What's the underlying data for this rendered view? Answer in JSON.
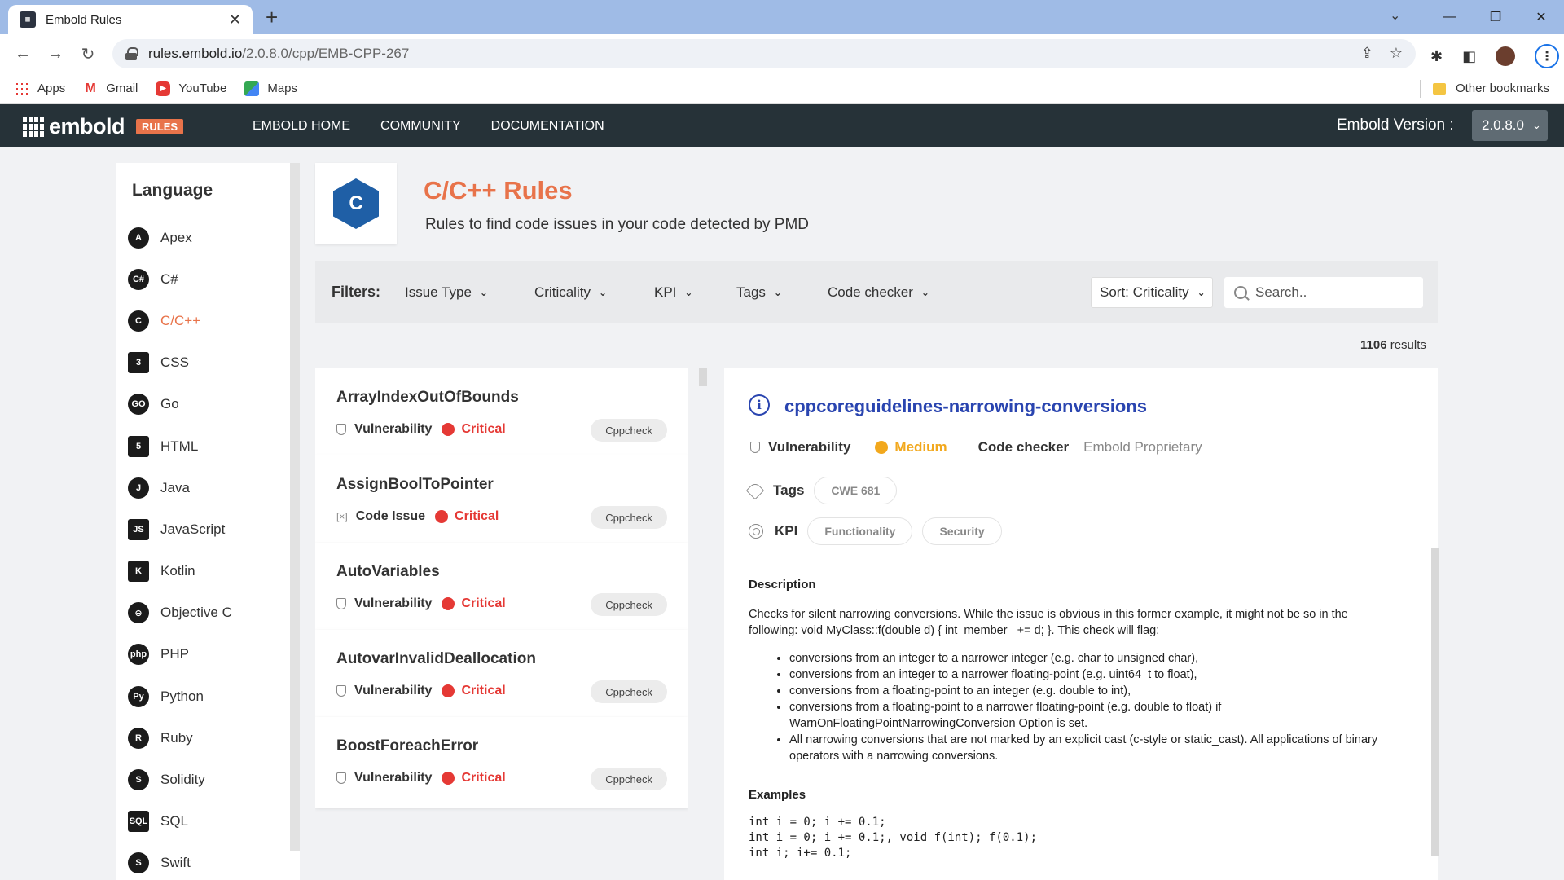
{
  "browser": {
    "tab_title": "Embold Rules",
    "url_host": "rules.embold.io",
    "url_path": "/2.0.8.0/cpp/EMB-CPP-267",
    "bookmarks": [
      "Apps",
      "Gmail",
      "YouTube",
      "Maps"
    ],
    "other_bookmarks": "Other bookmarks"
  },
  "header": {
    "logo": "embold",
    "badge": "RULES",
    "nav": [
      "EMBOLD HOME",
      "COMMUNITY",
      "DOCUMENTATION"
    ],
    "version_label": "Embold Version :",
    "version_value": "2.0.8.0"
  },
  "sidebar": {
    "title": "Language",
    "items": [
      {
        "label": "Apex",
        "icon": "apex-icon",
        "glyph": "A"
      },
      {
        "label": "C#",
        "icon": "csharp-icon",
        "glyph": "C#"
      },
      {
        "label": "C/C++",
        "icon": "cpp-icon",
        "glyph": "C",
        "active": true
      },
      {
        "label": "CSS",
        "icon": "css-icon",
        "glyph": "3"
      },
      {
        "label": "Go",
        "icon": "go-icon",
        "glyph": "GO"
      },
      {
        "label": "HTML",
        "icon": "html-icon",
        "glyph": "5"
      },
      {
        "label": "Java",
        "icon": "java-icon",
        "glyph": "J"
      },
      {
        "label": "JavaScript",
        "icon": "javascript-icon",
        "glyph": "JS"
      },
      {
        "label": "Kotlin",
        "icon": "kotlin-icon",
        "glyph": "K"
      },
      {
        "label": "Objective C",
        "icon": "objective-c-icon",
        "glyph": "⊖"
      },
      {
        "label": "PHP",
        "icon": "php-icon",
        "glyph": "php"
      },
      {
        "label": "Python",
        "icon": "python-icon",
        "glyph": "Py"
      },
      {
        "label": "Ruby",
        "icon": "ruby-icon",
        "glyph": "R"
      },
      {
        "label": "Solidity",
        "icon": "solidity-icon",
        "glyph": "S"
      },
      {
        "label": "SQL",
        "icon": "sql-icon",
        "glyph": "SQL"
      },
      {
        "label": "Swift",
        "icon": "swift-icon",
        "glyph": "S"
      }
    ]
  },
  "page": {
    "title": "C/C++ Rules",
    "subtitle": "Rules to find code issues in your code detected by PMD"
  },
  "filters": {
    "label": "Filters:",
    "dropdowns": [
      "Issue Type",
      "Criticality",
      "KPI",
      "Tags",
      "Code checker"
    ],
    "sort": "Sort: Criticality",
    "search_placeholder": "Search.."
  },
  "results": {
    "count": "1106",
    "label": "results"
  },
  "rules": [
    {
      "name": "ArrayIndexOutOfBounds",
      "type": "Vulnerability",
      "criticality": "Critical",
      "checker": "Cppcheck"
    },
    {
      "name": "AssignBoolToPointer",
      "type": "Code Issue",
      "criticality": "Critical",
      "checker": "Cppcheck"
    },
    {
      "name": "AutoVariables",
      "type": "Vulnerability",
      "criticality": "Critical",
      "checker": "Cppcheck"
    },
    {
      "name": "AutovarInvalidDeallocation",
      "type": "Vulnerability",
      "criticality": "Critical",
      "checker": "Cppcheck"
    },
    {
      "name": "BoostForeachError",
      "type": "Vulnerability",
      "criticality": "Critical",
      "checker": "Cppcheck"
    }
  ],
  "detail": {
    "title": "cppcoreguidelines-narrowing-conversions",
    "type": "Vulnerability",
    "criticality": "Medium",
    "code_checker_label": "Code checker",
    "code_checker_value": "Embold Proprietary",
    "tags_label": "Tags",
    "tags": [
      "CWE 681"
    ],
    "kpi_label": "KPI",
    "kpis": [
      "Functionality",
      "Security"
    ],
    "description_title": "Description",
    "description": "Checks for silent narrowing conversions. While the issue is obvious in this former example, it might not be so in the following: void MyClass::f(double d) { int_member_ += d; }. This check will flag:",
    "bullets": [
      "conversions from an integer to a narrower integer (e.g. char to unsigned char),",
      "conversions from an integer to a narrower floating-point (e.g. uint64_t to float),",
      "conversions from a floating-point to an integer (e.g. double to int),",
      "conversions from a floating-point to a narrower floating-point (e.g. double to float) if WarnOnFloatingPointNarrowingConversion Option is set.",
      "All narrowing conversions that are not marked by an explicit cast (c-style or static_cast). All applications of binary operators with a narrowing conversions."
    ],
    "examples_title": "Examples",
    "code": "int i = 0; i += 0.1;\nint i = 0; i += 0.1;, void f(int); f(0.1);\nint i; i+= 0.1;"
  },
  "colors": {
    "accent": "#e8734a",
    "link": "#2a45b0",
    "critical": "#e53935",
    "medium": "#f2a81d",
    "header_bg": "#263238"
  }
}
